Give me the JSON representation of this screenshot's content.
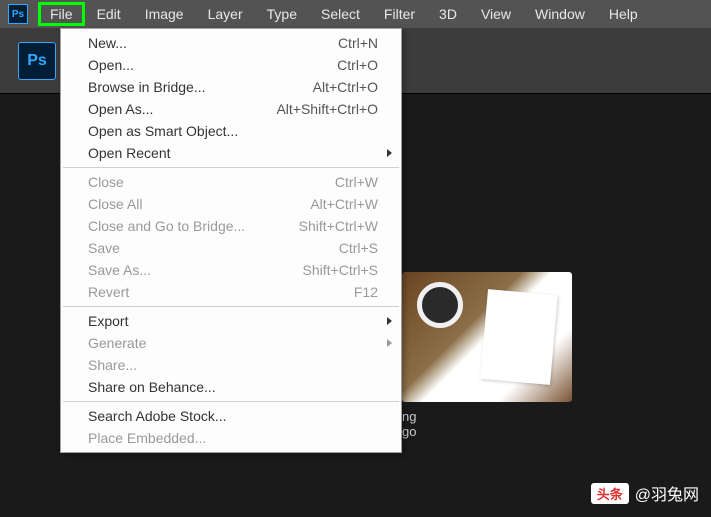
{
  "menubar": {
    "items": [
      "File",
      "Edit",
      "Image",
      "Layer",
      "Type",
      "Select",
      "Filter",
      "3D",
      "View",
      "Window",
      "Help"
    ],
    "active_index": 0
  },
  "dropdown": {
    "groups": [
      [
        {
          "label": "New...",
          "shortcut": "Ctrl+N",
          "enabled": true
        },
        {
          "label": "Open...",
          "shortcut": "Ctrl+O",
          "enabled": true
        },
        {
          "label": "Browse in Bridge...",
          "shortcut": "Alt+Ctrl+O",
          "enabled": true
        },
        {
          "label": "Open As...",
          "shortcut": "Alt+Shift+Ctrl+O",
          "enabled": true
        },
        {
          "label": "Open as Smart Object...",
          "shortcut": "",
          "enabled": true
        },
        {
          "label": "Open Recent",
          "shortcut": "",
          "enabled": true,
          "submenu": true
        }
      ],
      [
        {
          "label": "Close",
          "shortcut": "Ctrl+W",
          "enabled": false
        },
        {
          "label": "Close All",
          "shortcut": "Alt+Ctrl+W",
          "enabled": false
        },
        {
          "label": "Close and Go to Bridge...",
          "shortcut": "Shift+Ctrl+W",
          "enabled": false
        },
        {
          "label": "Save",
          "shortcut": "Ctrl+S",
          "enabled": false
        },
        {
          "label": "Save As...",
          "shortcut": "Shift+Ctrl+S",
          "enabled": false
        },
        {
          "label": "Revert",
          "shortcut": "F12",
          "enabled": false
        }
      ],
      [
        {
          "label": "Export",
          "shortcut": "",
          "enabled": true,
          "submenu": true
        },
        {
          "label": "Generate",
          "shortcut": "",
          "enabled": false,
          "submenu": true
        },
        {
          "label": "Share...",
          "shortcut": "",
          "enabled": false
        },
        {
          "label": "Share on Behance...",
          "shortcut": "",
          "enabled": true
        }
      ],
      [
        {
          "label": "Search Adobe Stock...",
          "shortcut": "",
          "enabled": true
        },
        {
          "label": "Place Embedded...",
          "shortcut": "",
          "enabled": false
        }
      ]
    ]
  },
  "thumbnail": {
    "label_1": "ng",
    "label_2": "go"
  },
  "watermark": {
    "badge": "头条",
    "text": "@羽兔网"
  },
  "brand": "Ps"
}
